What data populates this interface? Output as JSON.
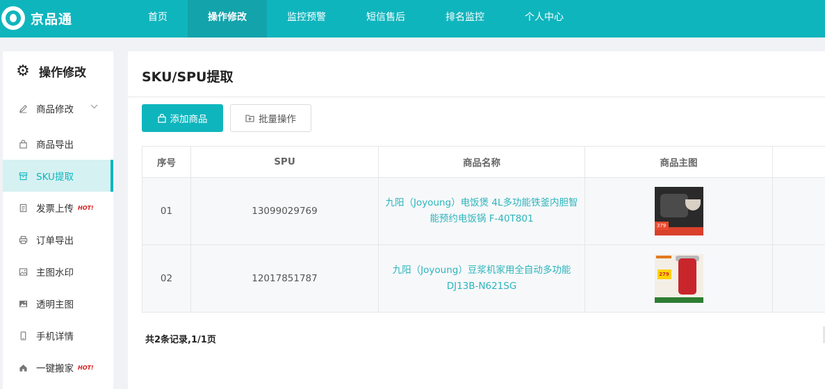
{
  "brand": {
    "name": "京品通",
    "logo_icon": "jingpintong-logo"
  },
  "nav": {
    "items": [
      {
        "label": "首页"
      },
      {
        "label": "操作修改",
        "active": true
      },
      {
        "label": "监控预警"
      },
      {
        "label": "短信售后"
      },
      {
        "label": "排名监控"
      },
      {
        "label": "个人中心"
      }
    ]
  },
  "sidebar": {
    "title": "操作修改",
    "title_icon": "gear-icon",
    "items": [
      {
        "label": "商品修改",
        "icon": "edit-icon",
        "has_dropdown": true
      },
      {
        "label": "商品导出",
        "icon": "bag-icon"
      },
      {
        "label": "SKU提取",
        "icon": "box-icon",
        "active": true
      },
      {
        "label": "发票上传",
        "icon": "document-icon",
        "badge": "HOT!"
      },
      {
        "label": "订单导出",
        "icon": "printer-icon"
      },
      {
        "label": "主图水印",
        "icon": "image-icon"
      },
      {
        "label": "透明主图",
        "icon": "picture-icon"
      },
      {
        "label": "手机详情",
        "icon": "phone-icon"
      },
      {
        "label": "一键搬家",
        "icon": "home-icon",
        "badge": "HOT!"
      }
    ]
  },
  "main": {
    "title": "SKU/SPU提取",
    "actions": {
      "add_label": "添加商品",
      "batch_label": "批量操作"
    },
    "table": {
      "columns": [
        "序号",
        "SPU",
        "商品名称",
        "商品主图",
        ""
      ],
      "rows": [
        {
          "index": "01",
          "spu": "13099029769",
          "name": "九阳（Joyoung）电饭煲 4L多功能铁釜内胆智能预约电饭锅 F-40T801",
          "image": "rice-cooker-product-image"
        },
        {
          "index": "02",
          "spu": "12017851787",
          "name": "九阳（Joyoung）豆浆机家用全自动多功能DJ13B-N621SG",
          "image": "soymilk-maker-product-image"
        }
      ]
    },
    "pagination_info": "共2条记录,1/1页"
  },
  "colors": {
    "primary": "#0fb5bd",
    "nav_active": "#13a3ab",
    "hot": "#d81b1b"
  }
}
